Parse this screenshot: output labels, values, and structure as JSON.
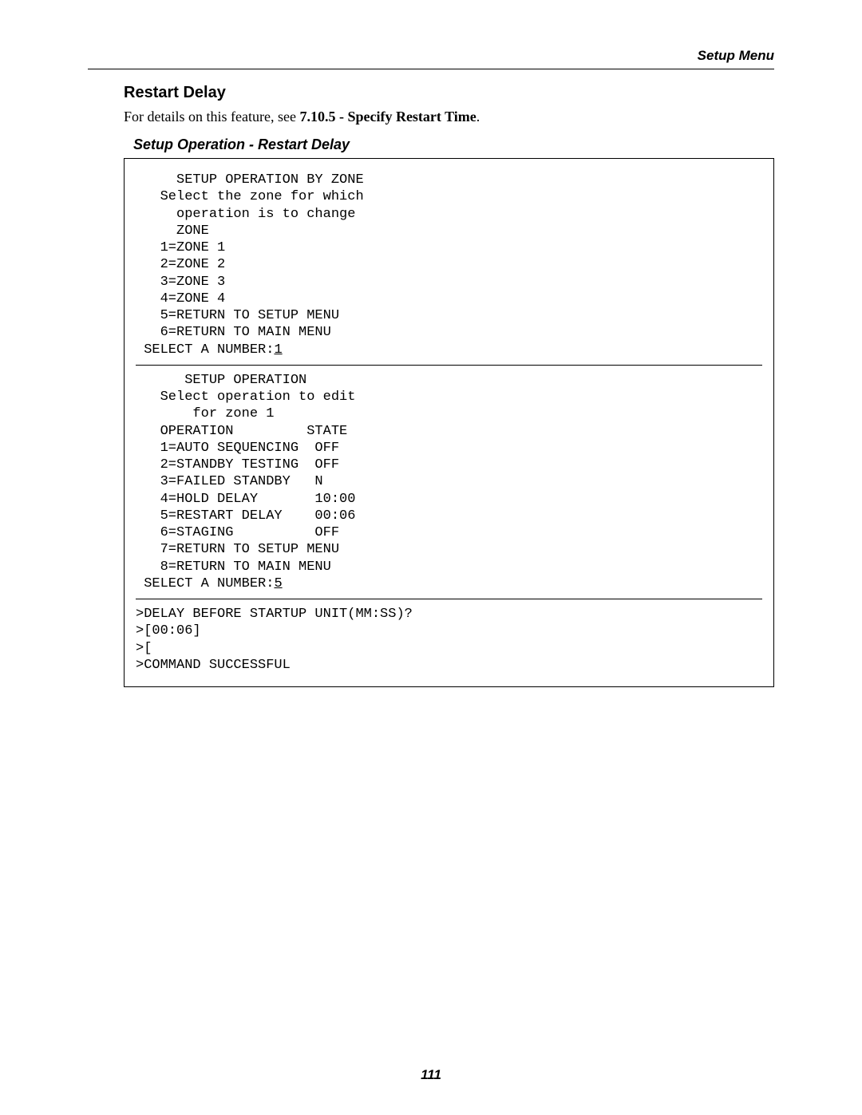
{
  "header": {
    "right": "Setup Menu"
  },
  "section": {
    "title": "Restart Delay",
    "body_prefix": "For details on this feature, see ",
    "body_bold": "7.10.5 - Specify Restart Time",
    "body_suffix": ".",
    "caption": "Setup Operation - Restart Delay"
  },
  "terminal": {
    "block1": {
      "l1": "     SETUP OPERATION BY ZONE",
      "l2": "",
      "l3": "   Select the zone for which",
      "l4": "     operation is to change",
      "l5": "",
      "l6": "     ZONE",
      "l7": "",
      "l8": "   1=ZONE 1",
      "l9": "   2=ZONE 2",
      "l10": "   3=ZONE 3",
      "l11": "   4=ZONE 4",
      "l12": "   5=RETURN TO SETUP MENU",
      "l13": "   6=RETURN TO MAIN MENU",
      "l14": "",
      "prompt": " SELECT A NUMBER:",
      "input": "1"
    },
    "block2": {
      "l1": "      SETUP OPERATION",
      "l2": "",
      "l3": "",
      "l4": "   Select operation to edit",
      "l5": "       for zone 1",
      "l6": "",
      "l7": "   OPERATION         STATE",
      "l8": "",
      "l9": "   1=AUTO SEQUENCING  OFF",
      "l10": "   2=STANDBY TESTING  OFF",
      "l11": "   3=FAILED STANDBY   N",
      "l12": "   4=HOLD DELAY       10:00",
      "l13": "   5=RESTART DELAY    00:06",
      "l14": "   6=STAGING          OFF",
      "l15": "   7=RETURN TO SETUP MENU",
      "l16": "   8=RETURN TO MAIN MENU",
      "l17": "",
      "prompt": " SELECT A NUMBER:",
      "input": "5"
    },
    "block3": {
      "l1": ">DELAY BEFORE STARTUP UNIT(MM:SS)?",
      "l2": ">[00:06]",
      "l3": ">[",
      "l4": ">COMMAND SUCCESSFUL"
    }
  },
  "page_number": "111"
}
